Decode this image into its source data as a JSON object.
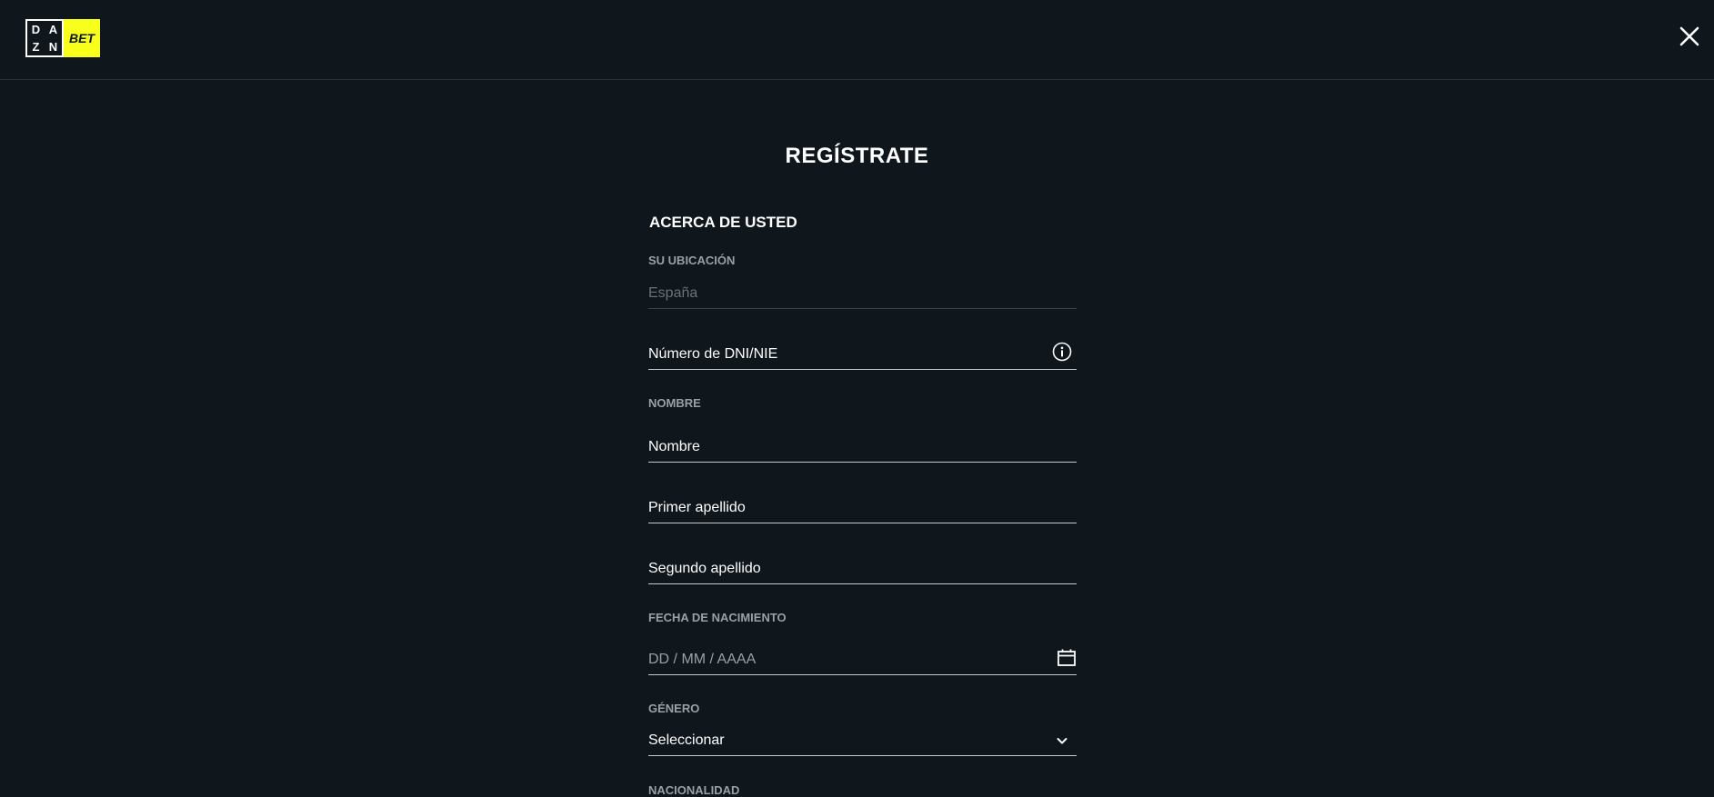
{
  "header": {
    "logo": {
      "dazn_letters": [
        "D",
        "A",
        "Z",
        "N"
      ],
      "bet": "BET",
      "brand_color": "#f7ff1a"
    },
    "close_icon": "close-icon"
  },
  "page": {
    "title": "REGÍSTRATE"
  },
  "form": {
    "section_heading": "ACERCA DE USTED",
    "location": {
      "label": "SU UBICACIÓN",
      "value": "España"
    },
    "dni": {
      "placeholder": "Número de DNI/NIE",
      "icon": "info-icon"
    },
    "name_label": "NOMBRE",
    "first_name": {
      "placeholder": "Nombre"
    },
    "first_surname": {
      "placeholder": "Primer apellido"
    },
    "second_surname": {
      "placeholder": "Segundo apellido"
    },
    "birthdate": {
      "label": "FECHA DE NACIMIENTO",
      "placeholder": "DD / MM / AAAA",
      "icon": "calendar-icon"
    },
    "gender": {
      "label": "GÉNERO",
      "selected": "Seleccionar",
      "icon": "chevron-down-icon"
    },
    "nationality": {
      "label": "NACIONALIDAD"
    }
  }
}
